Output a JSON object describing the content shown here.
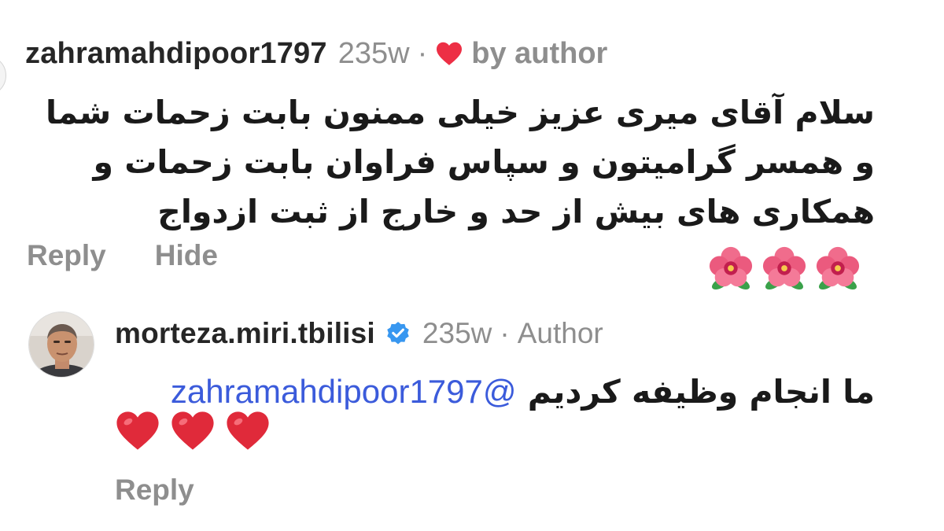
{
  "comment": {
    "username": "zahramahdipoor1797",
    "time": "235w",
    "separator": "·",
    "liked_by_author": "by author",
    "text": "سلام آقای میری عزیز خیلی ممنون بابت زحمات شما و همسر گرامیتون و سپاس فراوان بابت زحمات و همکاری های بیش از حد و خارج از ثبت ازدواج",
    "emoji_count": 3,
    "emoji_icon": "hibiscus-flower",
    "actions": {
      "reply": "Reply",
      "hide": "Hide"
    }
  },
  "reply": {
    "username": "morteza.miri.tbilisi",
    "verified": true,
    "time": "235w",
    "separator": "·",
    "role": "Author",
    "mention": "@zahramahdipoor1797",
    "text": "ما انجام وظیفه کردیم",
    "emoji_count": 3,
    "emoji_icon": "red-heart",
    "actions": {
      "reply": "Reply"
    }
  },
  "colors": {
    "username": "#262626",
    "secondary_text": "#8e8e8e",
    "mention": "#3b5bdb",
    "like_heart": "#ed2f45",
    "verified_badge": "#3897f0"
  }
}
